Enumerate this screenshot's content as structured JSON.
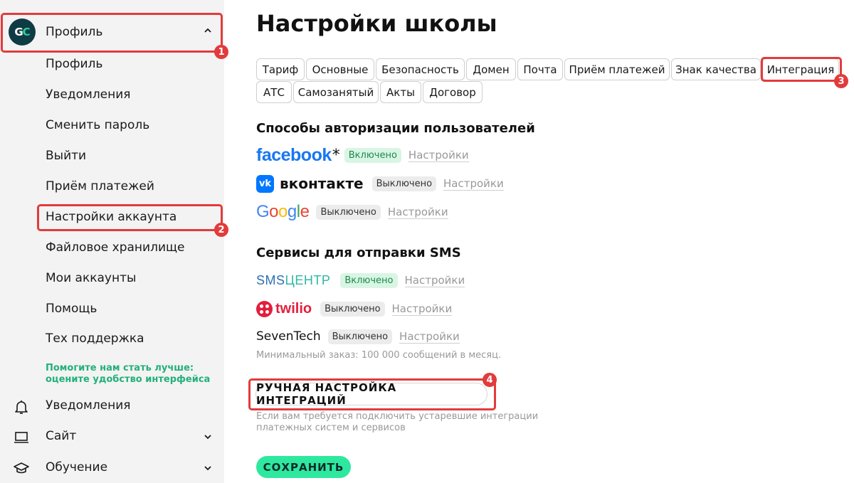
{
  "sidebar": {
    "avatar_text": "GC",
    "profile_label": "Профиль",
    "sub_items": [
      {
        "label": "Профиль"
      },
      {
        "label": "Уведомления"
      },
      {
        "label": "Сменить пароль"
      },
      {
        "label": "Выйти"
      },
      {
        "label": "Приём платежей"
      },
      {
        "label": "Настройки аккаунта"
      },
      {
        "label": "Файловое хранилище"
      },
      {
        "label": "Мои аккаунты"
      },
      {
        "label": "Помощь"
      },
      {
        "label": "Тех поддержка"
      }
    ],
    "feedback_line1": "Помогите нам стать лучше:",
    "feedback_line2": "оцените удобство интерфейса",
    "nav": [
      {
        "label": "Уведомления",
        "icon": "bell-icon"
      },
      {
        "label": "Сайт",
        "icon": "laptop-icon"
      },
      {
        "label": "Обучение",
        "icon": "graduation-cap-icon"
      }
    ]
  },
  "main": {
    "title": "Настройки школы",
    "tabs": [
      {
        "label": "Тариф"
      },
      {
        "label": "Основные"
      },
      {
        "label": "Безопасность"
      },
      {
        "label": "Домен"
      },
      {
        "label": "Почта"
      },
      {
        "label": "Приём платежей"
      },
      {
        "label": "Знак качества"
      },
      {
        "label": "Интеграция"
      },
      {
        "label": "АТС"
      },
      {
        "label": "Самозанятый"
      },
      {
        "label": "Акты"
      },
      {
        "label": "Договор"
      }
    ],
    "auth_section_title": "Способы авторизации пользователей",
    "auth_services": [
      {
        "name": "facebook",
        "mark": "*",
        "status": "Включено",
        "settings": "Настройки"
      },
      {
        "name": "вконтакте",
        "icon_text": "vk",
        "status": "Выключено",
        "settings": "Настройки"
      },
      {
        "name": "Google",
        "status": "Выключено",
        "settings": "Настройки"
      }
    ],
    "sms_section_title": "Сервисы для отправки SMS",
    "sms_services": [
      {
        "name_part1": "SMS",
        "name_part2": "ЦЕНТР",
        "status": "Включено",
        "settings": "Настройки"
      },
      {
        "name": "twilio",
        "status": "Выключено",
        "settings": "Настройки"
      },
      {
        "name": "SevenTech",
        "status": "Выключено",
        "settings": "Настройки"
      }
    ],
    "min_order_note": "Минимальный заказ: 100 000 сообщений в месяц.",
    "manual_button": "РУЧНАЯ НАСТРОЙКА ИНТЕГРАЦИЙ",
    "manual_note": "Если вам требуется подключить устаревшие интеграции платежных систем и сервисов",
    "save_button": "СОХРАНИТЬ"
  },
  "annotations": [
    "1",
    "2",
    "3",
    "4"
  ],
  "colors": {
    "annotation_red": "#e23b3b",
    "accent_green": "#2ee89f",
    "facebook_blue": "#1877f2",
    "vk_blue": "#0077ff",
    "twilio_red": "#e31e3c",
    "sms_blue": "#2d6fb5",
    "sms_green": "#2fb7a6"
  }
}
